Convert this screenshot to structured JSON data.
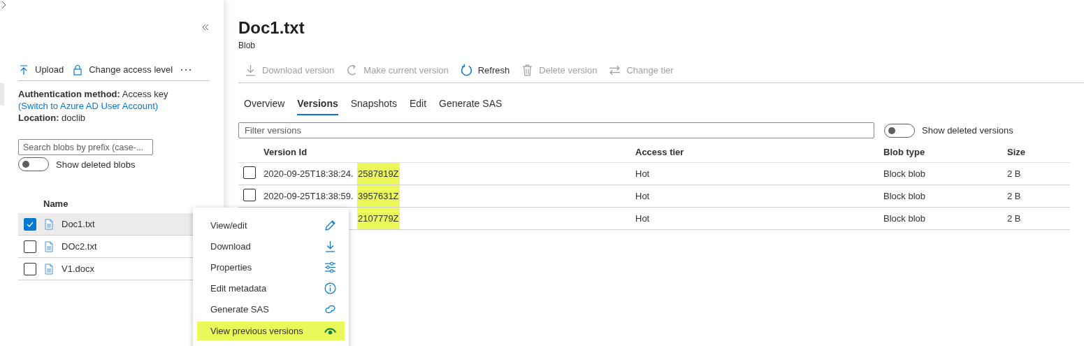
{
  "sidebar": {
    "toolbar": [
      {
        "kind": "upload",
        "label": "Upload"
      },
      {
        "kind": "lock",
        "label": "Change access level"
      },
      {
        "kind": "more"
      }
    ],
    "auth": {
      "label": "Authentication method:",
      "value": "Access key",
      "link": "(Switch to Azure AD User Account)"
    },
    "location": {
      "label": "Location:",
      "value": "doclib"
    },
    "search": {
      "placeholder": "Search blobs by prefix (case-..."
    },
    "show_deleted": {
      "label": "Show deleted blobs",
      "on": false
    },
    "list": {
      "column": "Name",
      "rows": [
        {
          "name": "Doc1.txt",
          "selected": true
        },
        {
          "name": "DOc2.txt",
          "selected": false
        },
        {
          "name": "V1.docx",
          "selected": false
        }
      ]
    }
  },
  "blob": {
    "title": "Doc1.txt",
    "subtitle": "Blob",
    "toolbar": [
      {
        "kind": "download",
        "label": "Download version",
        "disabled": true
      },
      {
        "kind": "restore",
        "label": "Make current version",
        "disabled": true
      },
      {
        "kind": "refresh",
        "label": "Refresh",
        "disabled": false
      },
      {
        "kind": "delete",
        "label": "Delete version",
        "disabled": true
      },
      {
        "kind": "swap",
        "label": "Change tier",
        "disabled": true
      }
    ],
    "tabs": [
      {
        "label": "Overview",
        "selected": false
      },
      {
        "label": "Versions",
        "selected": true
      },
      {
        "label": "Snapshots",
        "selected": false
      },
      {
        "label": "Edit",
        "selected": false
      },
      {
        "label": "Generate SAS",
        "selected": false
      }
    ],
    "filter": {
      "placeholder": "Filter versions"
    },
    "show_deleted": {
      "label": "Show deleted versions",
      "on": false
    },
    "versions": {
      "columns": [
        "Version Id",
        "Access tier",
        "Blob type",
        "Size"
      ],
      "rows": [
        {
          "selected": false,
          "id_start": "2020-09-25T18:38:24.",
          "id_end": "2587819Z",
          "access_tier": "Hot",
          "blob_type": "Block blob",
          "size": "2 B"
        },
        {
          "selected": false,
          "id_start": "2020-09-25T18:38:59.",
          "id_end": "3957631Z",
          "access_tier": "Hot",
          "blob_type": "Block blob",
          "size": "2 B"
        },
        {
          "id_end": "2107779Z",
          "access_tier": "Hot",
          "blob_type": "Block blob",
          "size": "2 B"
        }
      ]
    }
  },
  "context_menu": {
    "items": [
      {
        "kind": "edit",
        "label": "View/edit",
        "highlighted": false
      },
      {
        "kind": "download",
        "label": "Download",
        "highlighted": false
      },
      {
        "kind": "properties",
        "label": "Properties",
        "highlighted": false
      },
      {
        "kind": "info",
        "label": "Edit metadata",
        "highlighted": false
      },
      {
        "kind": "link",
        "label": "Generate SAS",
        "highlighted": false
      },
      {
        "kind": "eye",
        "label": "View previous versions",
        "highlighted": true
      }
    ]
  }
}
